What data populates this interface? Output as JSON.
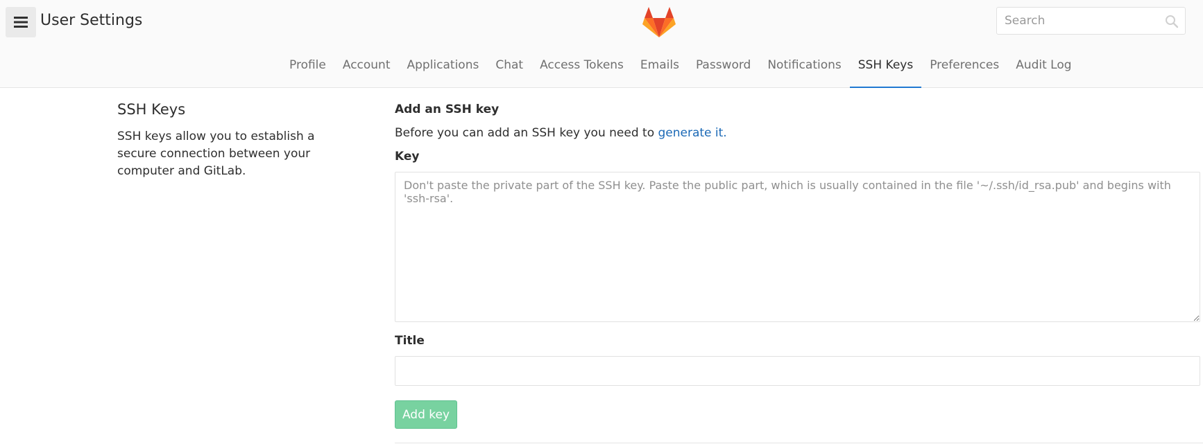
{
  "header": {
    "title": "User Settings",
    "menu_icon": "hamburger-icon",
    "logo_icon": "gitlab-tanuki-logo",
    "search": {
      "placeholder": "Search",
      "icon": "search-icon"
    }
  },
  "nav": {
    "tabs": [
      {
        "label": "Profile",
        "active": false
      },
      {
        "label": "Account",
        "active": false
      },
      {
        "label": "Applications",
        "active": false
      },
      {
        "label": "Chat",
        "active": false
      },
      {
        "label": "Access Tokens",
        "active": false
      },
      {
        "label": "Emails",
        "active": false
      },
      {
        "label": "Password",
        "active": false
      },
      {
        "label": "Notifications",
        "active": false
      },
      {
        "label": "SSH Keys",
        "active": true
      },
      {
        "label": "Preferences",
        "active": false
      },
      {
        "label": "Audit Log",
        "active": false
      }
    ]
  },
  "section": {
    "title": "SSH Keys",
    "description": "SSH keys allow you to establish a secure connection between your computer and GitLab."
  },
  "form": {
    "heading": "Add an SSH key",
    "intro_text": "Before you can add an SSH key you need to ",
    "intro_link": "generate it.",
    "key_label": "Key",
    "key_placeholder": "Don't paste the private part of the SSH key. Paste the public part, which is usually contained in the file '~/.ssh/id_rsa.pub' and begins with 'ssh-rsa'.",
    "key_value": "",
    "title_label": "Title",
    "title_value": "",
    "submit_label": "Add key"
  },
  "colors": {
    "active_tab_underline": "#1f78d1",
    "link": "#1b69b6",
    "button_bg": "#78d2a0",
    "header_bg": "#fafafa"
  }
}
